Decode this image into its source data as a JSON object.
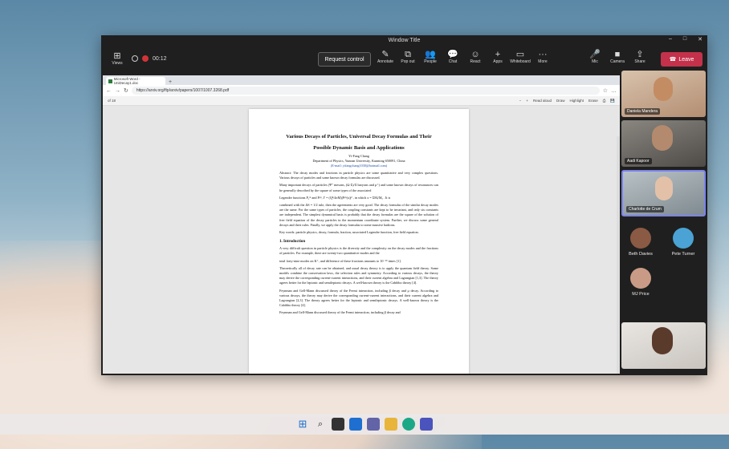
{
  "window": {
    "title": "Window Title"
  },
  "meeting": {
    "timer": "00:12",
    "request_control": "Request control",
    "leave": "Leave",
    "tools_left": [
      {
        "icon": "grid-icon",
        "label": "Views"
      }
    ],
    "tools_mid": [
      {
        "icon": "pen-icon",
        "label": "Annotate"
      },
      {
        "icon": "popout-icon",
        "label": "Pop out"
      },
      {
        "icon": "people-icon",
        "label": "People"
      },
      {
        "icon": "chat-icon",
        "label": "Chat"
      },
      {
        "icon": "react-icon",
        "label": "React"
      },
      {
        "icon": "apps-icon",
        "label": "Apps"
      },
      {
        "icon": "whiteboard-icon",
        "label": "Whiteboard"
      },
      {
        "icon": "more-icon",
        "label": "More"
      }
    ],
    "tools_right": [
      {
        "icon": "mic-icon",
        "label": "Mic"
      },
      {
        "icon": "camera-icon",
        "label": "Camera"
      },
      {
        "icon": "share-icon",
        "label": "Share"
      }
    ]
  },
  "browser": {
    "tab_title": "Microsoft Word - UniDecay1.doc",
    "url": "https://arxiv.org/ftp/arxiv/papers/1007/1007.3268.pdf",
    "pdf": {
      "page_of": "of 18",
      "tools": [
        "Read aloud",
        "Draw",
        "Highlight",
        "Erase"
      ]
    }
  },
  "paper": {
    "title1": "Various Decays of Particles, Universal Decay Formulas and Their",
    "title2": "Possible Dynamic Basis and Applications",
    "author": "Yi-Fang Chang",
    "affiliation": "Department of Physics, Yunnan University, Kunming 650091, China",
    "email": "(E-mail: yifangchang1030@hotmail.com)",
    "abstract1": "Abstract: The decay modes and fractions in particle physics are some quantitative and very complex questions. Various decays of particles and some known decay formulas are discussed.",
    "abstract2": "Many important decays of particles (Ψ′′ mesons, (Ω·Σ)/Ξ baryons and  μ⁺) and some known decays of resonances can be generally described by the square of some types of the associated",
    "abstract3": "Legendre functions  P₁ᵐ and  Pₗᵐ,  Γ = (Q²/4πM)|Pₗᵐ(x)|² ,    in which x = ΣMᵢ/Mₐ . It is",
    "abstract4": "combined with the  ΔS = 1/2 rule, then the agreements are very good. The decay formulas of the similar decay modes are the same. For the same types of particles, the coupling constants are kept to be invariant, and only six constants are independent. The simplest dynamical basis is probably that the decay formulas are the square of the solution of free field equation of the decay particles in the momentum coordinate system. Further, we discuss some general decays and their rules. Finally, we apply the decay formulas to some massive hadrons.",
    "keywords": "Key words: particle physics, decay, formula, fraction, associated Legendre function, free field equation.",
    "sec1": "1. Introduction",
    "intro1": "A very difficult question in particle physics is the diversity and the complexity on the decay modes and the fractions of particles. For example, there are twenty-two quantitative modes and the",
    "intro2": "total forty-nine modes on  K⁺, and difference of these fractions amounts to  10⁻¹⁰ times [1].",
    "intro3": "Theoretically all of decay rate can be obtained, and usual decay theory is to apply the quantum field theory. Some models combine the conservation laws, the selection rules and symmetry. According to various decays, the theory may derive the corresponding current-current interactions, and their current algebra and Lagrangian [1,3]. The theory agrees better for the leptonic and semileptonic decays. A well-known theory is the Cabibbo theory [4].",
    "intro4": "Feynman and Gell-Mann discussed theory of the Fermi interaction, including  β decay and μ decay. According to various decays, the theory may derive the corresponding current-current interactions, and their current algebra and Lagrangian [2,3]. The theory agrees better for the leptonic and semileptonic decays. A well-known theory is the Cabibbo theory [4].",
    "intro5": "Feynman and Gell-Mann discussed theory of the Fermi interaction, including  β decay and"
  },
  "participants": [
    {
      "name": "Daniela Mandera",
      "bg": "#c9a98d"
    },
    {
      "name": "Aadi Kapoor",
      "bg": "#6e6a64"
    },
    {
      "name": "Charlotte de Crum",
      "bg": "#9aa3a8"
    }
  ],
  "avatars": [
    {
      "name": "Beth Davies",
      "color": "#8a5a44"
    },
    {
      "name": "Pete Turner",
      "color": "#4aa3d4"
    },
    {
      "name": "MJ Price",
      "color": "#c99b86"
    }
  ]
}
